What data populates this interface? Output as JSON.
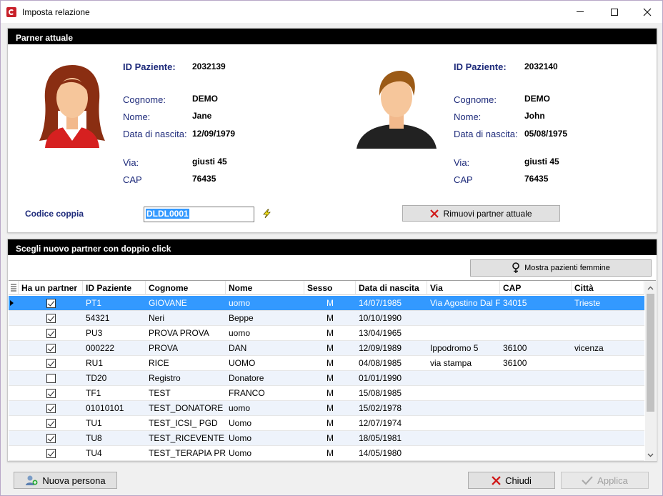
{
  "window": {
    "title": "Imposta relazione"
  },
  "current_partner": {
    "header": "Parner attuale",
    "labels": {
      "id": "ID Paziente:",
      "surname": "Cognome:",
      "name": "Nome:",
      "birth": "Data di nascita:",
      "street": "Via:",
      "zip": "CAP"
    },
    "female": {
      "id": "2032139",
      "surname": "DEMO",
      "name": "Jane",
      "birth": "12/09/1979",
      "street": "giusti 45",
      "zip": "76435"
    },
    "male": {
      "id": "2032140",
      "surname": "DEMO",
      "name": "John",
      "birth": "05/08/1975",
      "street": "giusti 45",
      "zip": "76435"
    },
    "couple_code_label": "Codice coppia",
    "couple_code_value": "DLDL0001",
    "remove_button": "Rimuovi partner attuale"
  },
  "new_partner": {
    "header": "Scegli nuovo partner con doppio click",
    "show_females_button": "Mostra pazienti femmine",
    "columns": [
      "Ha un partner",
      "ID Paziente",
      "Cognome",
      "Nome",
      "Sesso",
      "Data di nascita",
      "Via",
      "CAP",
      "Città"
    ],
    "rows": [
      {
        "partner": true,
        "id": "PT1",
        "surname": "GIOVANE",
        "name": "uomo",
        "sex": "M",
        "birth": "14/07/1985",
        "street": "Via Agostino Dal Fe",
        "zip": "34015",
        "city": "Trieste"
      },
      {
        "partner": true,
        "id": "54321",
        "surname": "Neri",
        "name": "Beppe",
        "sex": "M",
        "birth": "10/10/1990",
        "street": "",
        "zip": "",
        "city": ""
      },
      {
        "partner": true,
        "id": "PU3",
        "surname": "PROVA PROVA",
        "name": "uomo",
        "sex": "M",
        "birth": "13/04/1965",
        "street": "",
        "zip": "",
        "city": ""
      },
      {
        "partner": true,
        "id": "000222",
        "surname": "PROVA",
        "name": "DAN",
        "sex": "M",
        "birth": "12/09/1989",
        "street": "Ippodromo 5",
        "zip": "36100",
        "city": "vicenza"
      },
      {
        "partner": true,
        "id": "RU1",
        "surname": "RICE",
        "name": "UOMO",
        "sex": "M",
        "birth": "04/08/1985",
        "street": "via stampa",
        "zip": "36100",
        "city": ""
      },
      {
        "partner": false,
        "id": "TD20",
        "surname": "Registro",
        "name": "Donatore",
        "sex": "M",
        "birth": "01/01/1990",
        "street": "",
        "zip": "",
        "city": ""
      },
      {
        "partner": true,
        "id": "TF1",
        "surname": "TEST",
        "name": "FRANCO",
        "sex": "M",
        "birth": "15/08/1985",
        "street": "",
        "zip": "",
        "city": ""
      },
      {
        "partner": true,
        "id": "01010101",
        "surname": "TEST_DONATORE",
        "name": "uomo",
        "sex": "M",
        "birth": "15/02/1978",
        "street": "",
        "zip": "",
        "city": ""
      },
      {
        "partner": true,
        "id": "TU1",
        "surname": "TEST_ICSI_ PGD",
        "name": "Uomo",
        "sex": "M",
        "birth": "12/07/1974",
        "street": "",
        "zip": "",
        "city": ""
      },
      {
        "partner": true,
        "id": "TU8",
        "surname": "TEST_RICEVENTE",
        "name": "Uomo",
        "sex": "M",
        "birth": "18/05/1981",
        "street": "",
        "zip": "",
        "city": ""
      },
      {
        "partner": true,
        "id": "TU4",
        "surname": "TEST_TERAPIA PR",
        "name": "Uomo",
        "sex": "M",
        "birth": "14/05/1980",
        "street": "",
        "zip": "",
        "city": ""
      }
    ]
  },
  "footer": {
    "new_person": "Nuova persona",
    "close": "Chiudi",
    "apply": "Applica"
  },
  "colors": {
    "selection": "#3399ff",
    "label_blue": "#1d2a7a",
    "header_bg": "#000000"
  }
}
